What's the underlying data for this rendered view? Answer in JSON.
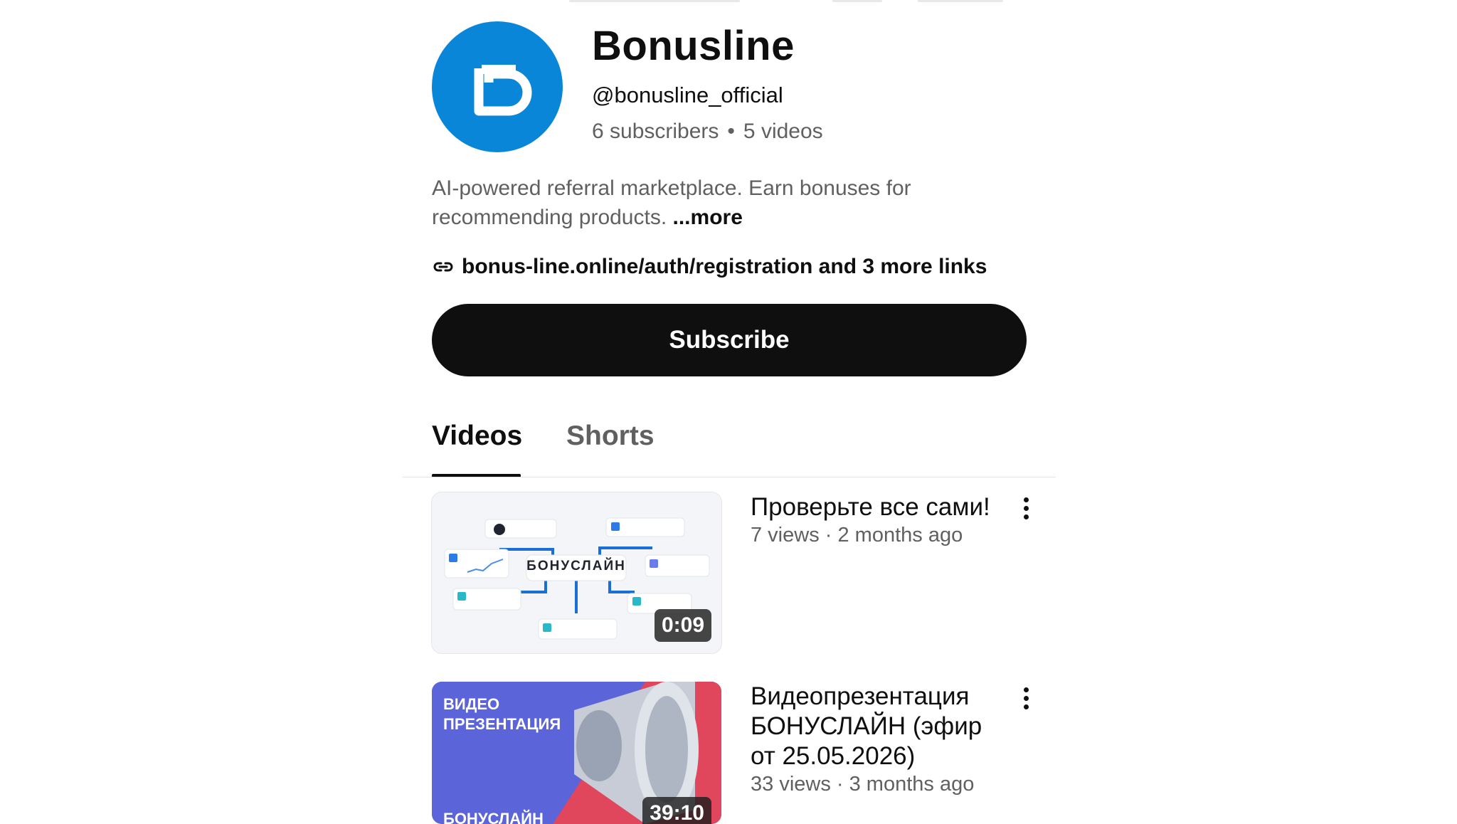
{
  "channel": {
    "name": "Bonusline",
    "handle": "@bonusline_official",
    "subscribers": "6 subscribers",
    "videos_count": "5 videos",
    "separator": "•",
    "description": "AI-powered referral marketplace. Earn bonuses for recommending products.",
    "more_label": "...more",
    "links_text": "bonus-line.online/auth/registration and 3 more links",
    "avatar_color": "#0a86d9",
    "avatar_icon": "bonusline-logo-icon",
    "link_icon": "link-icon"
  },
  "actions": {
    "subscribe_label": "Subscribe"
  },
  "tabs": [
    {
      "label": "Videos",
      "active": true
    },
    {
      "label": "Shorts",
      "active": false
    }
  ],
  "videos": [
    {
      "title": "Проверьте все сами!",
      "meta": "7 views · 2 months ago",
      "duration": "0:09",
      "thumb_text": "БОНУСЛАЙН"
    },
    {
      "title": "Видеопрезентация БОНУСЛАЙН (эфир от 25.05.2026)",
      "meta": "33 views · 3 months ago",
      "duration": "39:10",
      "thumb_text_1": "ВИДЕО",
      "thumb_text_2": "ПРЕЗЕНТАЦИЯ",
      "thumb_text_3": "БОНУСЛАЙН"
    }
  ]
}
